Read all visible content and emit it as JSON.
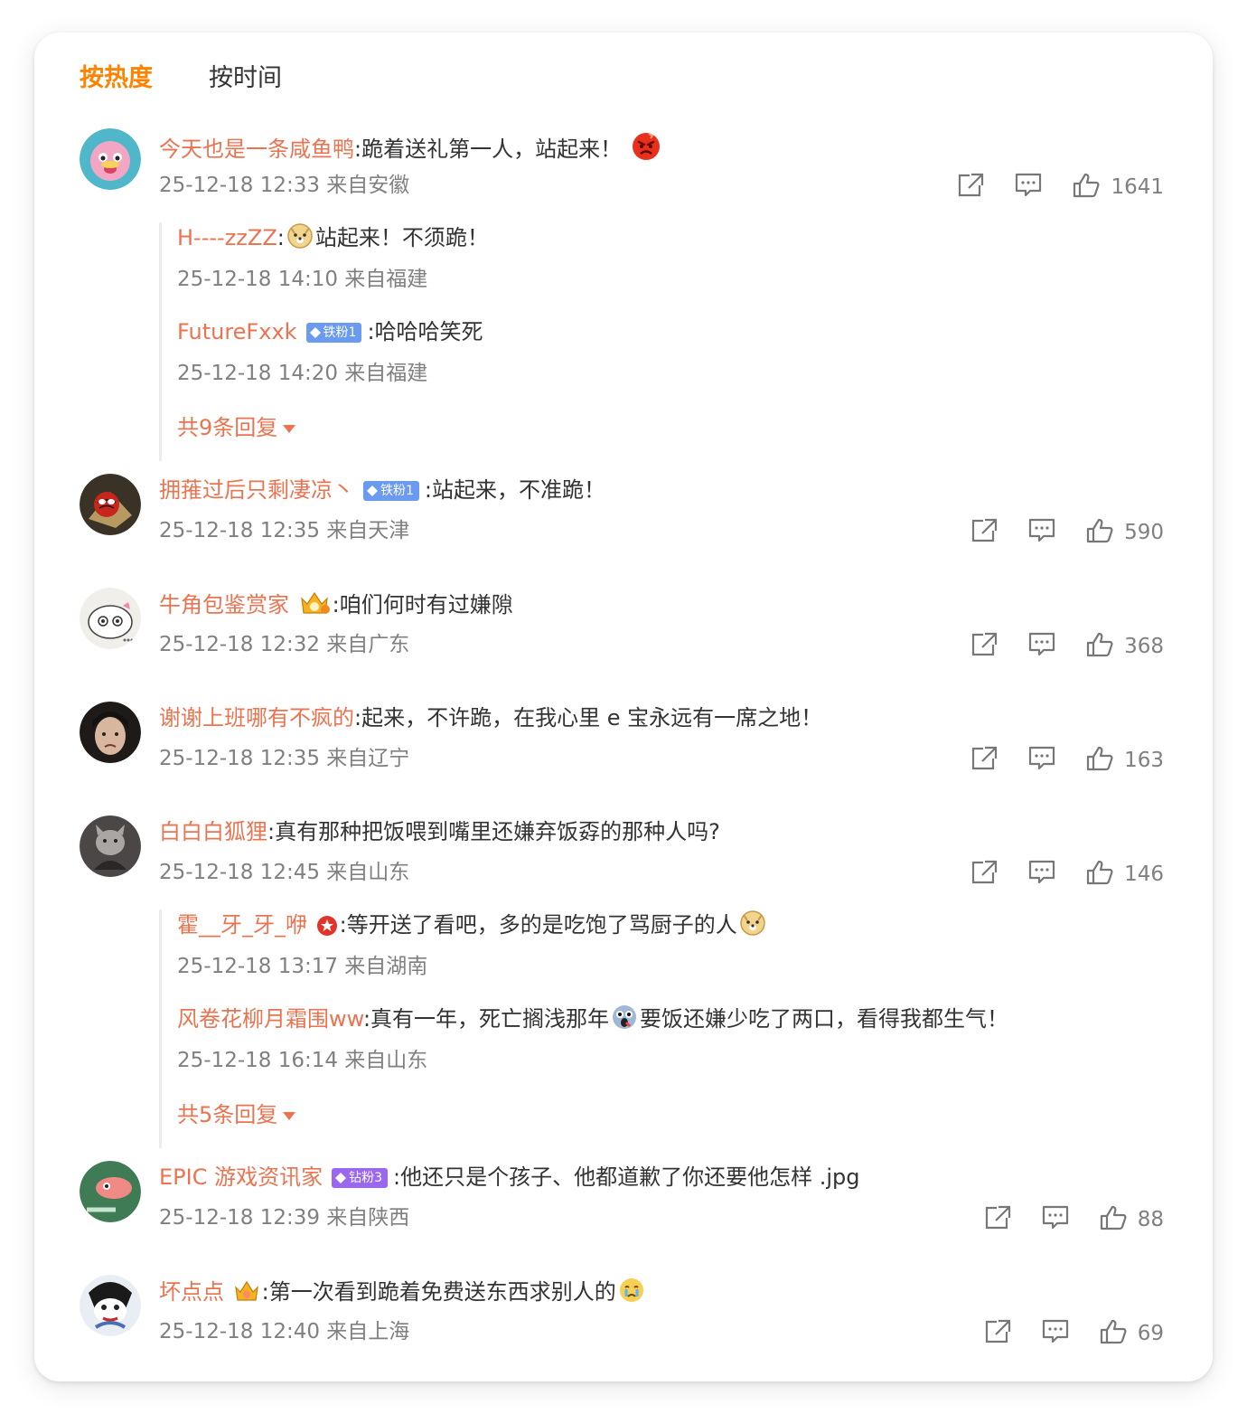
{
  "tabs": {
    "hot": "按热度",
    "time": "按时间"
  },
  "comments": [
    {
      "user": "今天也是一条咸鱼鸭",
      "text": "跪着送礼第一人，站起来！",
      "emoji": "angry-face-icon",
      "meta": "25-12-18 12:33 来自安徽",
      "likes": "1641",
      "replies": [
        {
          "user": "H----zzZZ",
          "emoji": "doge-icon",
          "text": "站起来！不须跪！",
          "meta": "25-12-18 14:10 来自福建"
        },
        {
          "user": "FutureFxxk",
          "badge": "铁粉1",
          "text": "哈哈哈笑死",
          "meta": "25-12-18 14:20 来自福建"
        }
      ],
      "more": "共9条回复"
    },
    {
      "user": "拥蓷过后只剩凄凉丶",
      "badge": "铁粉1",
      "text": "站起来，不准跪！",
      "meta": "25-12-18 12:35 来自天津",
      "likes": "590"
    },
    {
      "user": "牛角包鉴赏家",
      "badge_icon": "crown-medal-icon",
      "text": "咱们何时有过嫌隙",
      "meta": "25-12-18 12:32 来自广东",
      "likes": "368"
    },
    {
      "user": "谢谢上班哪有不疯的",
      "text": "起来，不许跪，在我心里 e 宝永远有一席之地！",
      "meta": "25-12-18 12:35 来自辽宁",
      "likes": "163"
    },
    {
      "user": "白白白狐狸",
      "text": "真有那种把饭喂到嘴里还嫌弃饭孬的那种人吗?",
      "meta": "25-12-18 12:45 来自山东",
      "likes": "146",
      "replies": [
        {
          "user": "霍__牙_牙_咿",
          "badge_icon": "red-star-badge-icon",
          "text": "等开送了看吧，多的是吃饱了骂厨子的人",
          "emoji": "doge-icon",
          "meta": "25-12-18 13:17 来自湖南"
        },
        {
          "user": "风卷花柳月霜围ww",
          "text": "真有一年，死亡搁浅那年",
          "emoji": "scared-face-icon",
          "text2": "要饭还嫌少吃了两口，看得我都生气！",
          "meta": "25-12-18 16:14 来自山东"
        }
      ],
      "more": "共5条回复"
    },
    {
      "user": "EPIC 游戏资讯家",
      "badge": "钻粉3",
      "text": "他还只是个孩子、他都道歉了你还要他怎样 .jpg",
      "meta": "25-12-18 12:39 来自陕西",
      "likes": "88"
    },
    {
      "user": "坏点点",
      "badge_icon": "crown-medal-icon",
      "text": "第一次看到跪着免费送东西求别人的",
      "emoji": "crying-face-icon",
      "meta": "25-12-18 12:40 来自上海",
      "likes": "69"
    }
  ],
  "colors": {
    "accent": "#ff8200",
    "username": "#eb7350",
    "meta": "#808080",
    "text": "#333333"
  }
}
